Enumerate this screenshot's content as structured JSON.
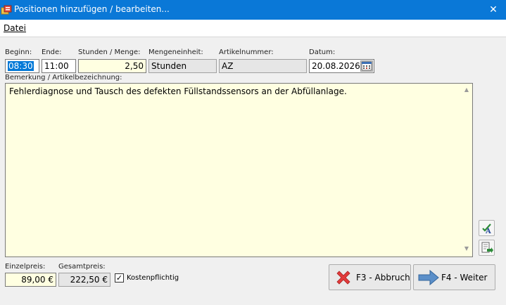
{
  "window": {
    "title": "Positionen hinzufügen / bearbeiten...",
    "close_glyph": "✕"
  },
  "menu": {
    "items": [
      {
        "label": "Datei"
      }
    ]
  },
  "form": {
    "beginn": {
      "label": "Beginn:",
      "value": "08:30"
    },
    "ende": {
      "label": "Ende:",
      "value": "11:00"
    },
    "stunden": {
      "label": "Stunden / Menge:",
      "value": "2,50"
    },
    "mengeneinheit": {
      "label": "Mengeneinheit:",
      "value": "Stunden"
    },
    "artikelnummer": {
      "label": "Artikelnummer:",
      "value": "AZ"
    },
    "datum": {
      "label": "Datum:",
      "value": "20.08.2026"
    },
    "bemerkung": {
      "label": "Bemerkung / Artikelbezeichnung:",
      "value": "Fehlerdiagnose und Tausch des defekten Füllstandssensors an der Abfüllanlage."
    },
    "einzelpreis": {
      "label": "Einzelpreis:",
      "value": "89,00 €"
    },
    "gesamtpreis": {
      "label": "Gesamtpreis:",
      "value": "222,50 €"
    },
    "kostenpflichtig": {
      "label": "Kostenpflichtig",
      "checked": true
    }
  },
  "buttons": {
    "abbruch": "F3 - Abbruch",
    "weiter": "F4 - Weiter"
  },
  "icons": {
    "app": "app-icon",
    "calendar": "calendar-icon",
    "spellcheck": "spellcheck-icon",
    "insert_text": "insert-text-icon",
    "cancel": "red-x-icon",
    "next": "blue-arrow-icon"
  },
  "colors": {
    "titlebar": "#0a78d7",
    "field_yellow": "#ffffe1",
    "selection": "#0078d7",
    "cancel_red": "#e23b3b",
    "arrow_blue": "#5b8fc9"
  }
}
